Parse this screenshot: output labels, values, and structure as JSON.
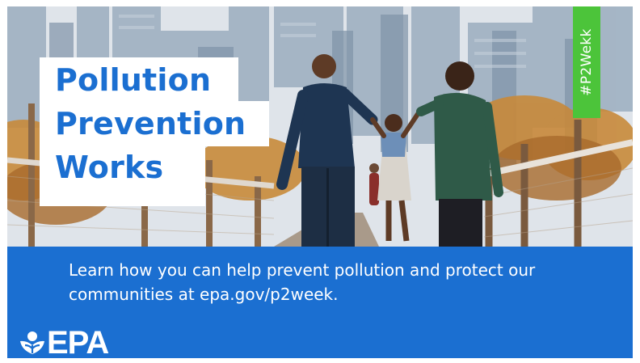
{
  "title": {
    "line1": "Pollution",
    "line2": "Prevention",
    "line3": "Works"
  },
  "hashtag": "#P2Wekk",
  "message": "Learn how you can help prevent pollution and protect our communities at epa.gov/p2week.",
  "logo": {
    "text": "EPA"
  },
  "colors": {
    "brand_blue": "#1b6fd1",
    "hashtag_green": "#4cc43a",
    "title_bg": "#ffffff"
  },
  "photo": {
    "icon": "family-walking-photo"
  }
}
